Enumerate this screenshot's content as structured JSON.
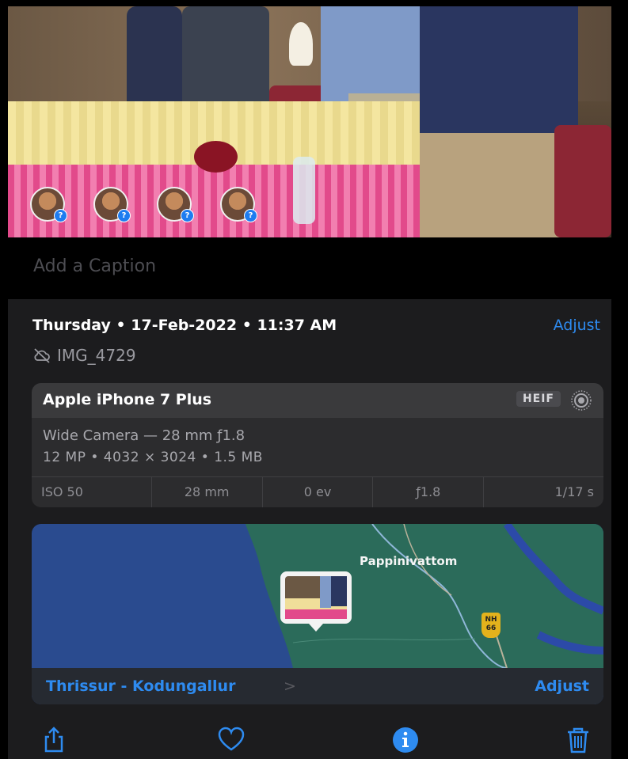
{
  "caption": {
    "placeholder": "Add a Caption"
  },
  "info": {
    "datetime": "Thursday • 17-Feb-2022 • 11:37 AM",
    "adjust_label": "Adjust",
    "filename": "IMG_4729",
    "cloud_icon": "cloud-slash-icon"
  },
  "camera": {
    "device": "Apple iPhone 7 Plus",
    "format_badge": "HEIF",
    "live_icon": "live-photo-icon",
    "lens": "Wide Camera — 28 mm ƒ1.8",
    "specs": "12 MP • 4032 × 3024 • 1.5 MB",
    "exif": [
      "ISO 50",
      "28 mm",
      "0 ev",
      "ƒ1.8",
      "1/17 s"
    ]
  },
  "map": {
    "place_label": "Pappinivattom",
    "highway_badge": [
      "NH",
      "66"
    ],
    "location": "Thrissur - Kodungallur",
    "chevron": ">",
    "adjust_label": "Adjust"
  },
  "faces": [
    {
      "name": "face-1",
      "badge": "?"
    },
    {
      "name": "face-2",
      "badge": "?"
    },
    {
      "name": "face-3",
      "badge": "?"
    },
    {
      "name": "face-4",
      "badge": "?"
    }
  ],
  "toolbar": {
    "items": [
      "share-icon",
      "heart-icon",
      "info-icon",
      "trash-icon"
    ]
  },
  "colors": {
    "accent": "#2e8bf0",
    "background": "#1c1c1e",
    "card": "#2c2c2e"
  }
}
